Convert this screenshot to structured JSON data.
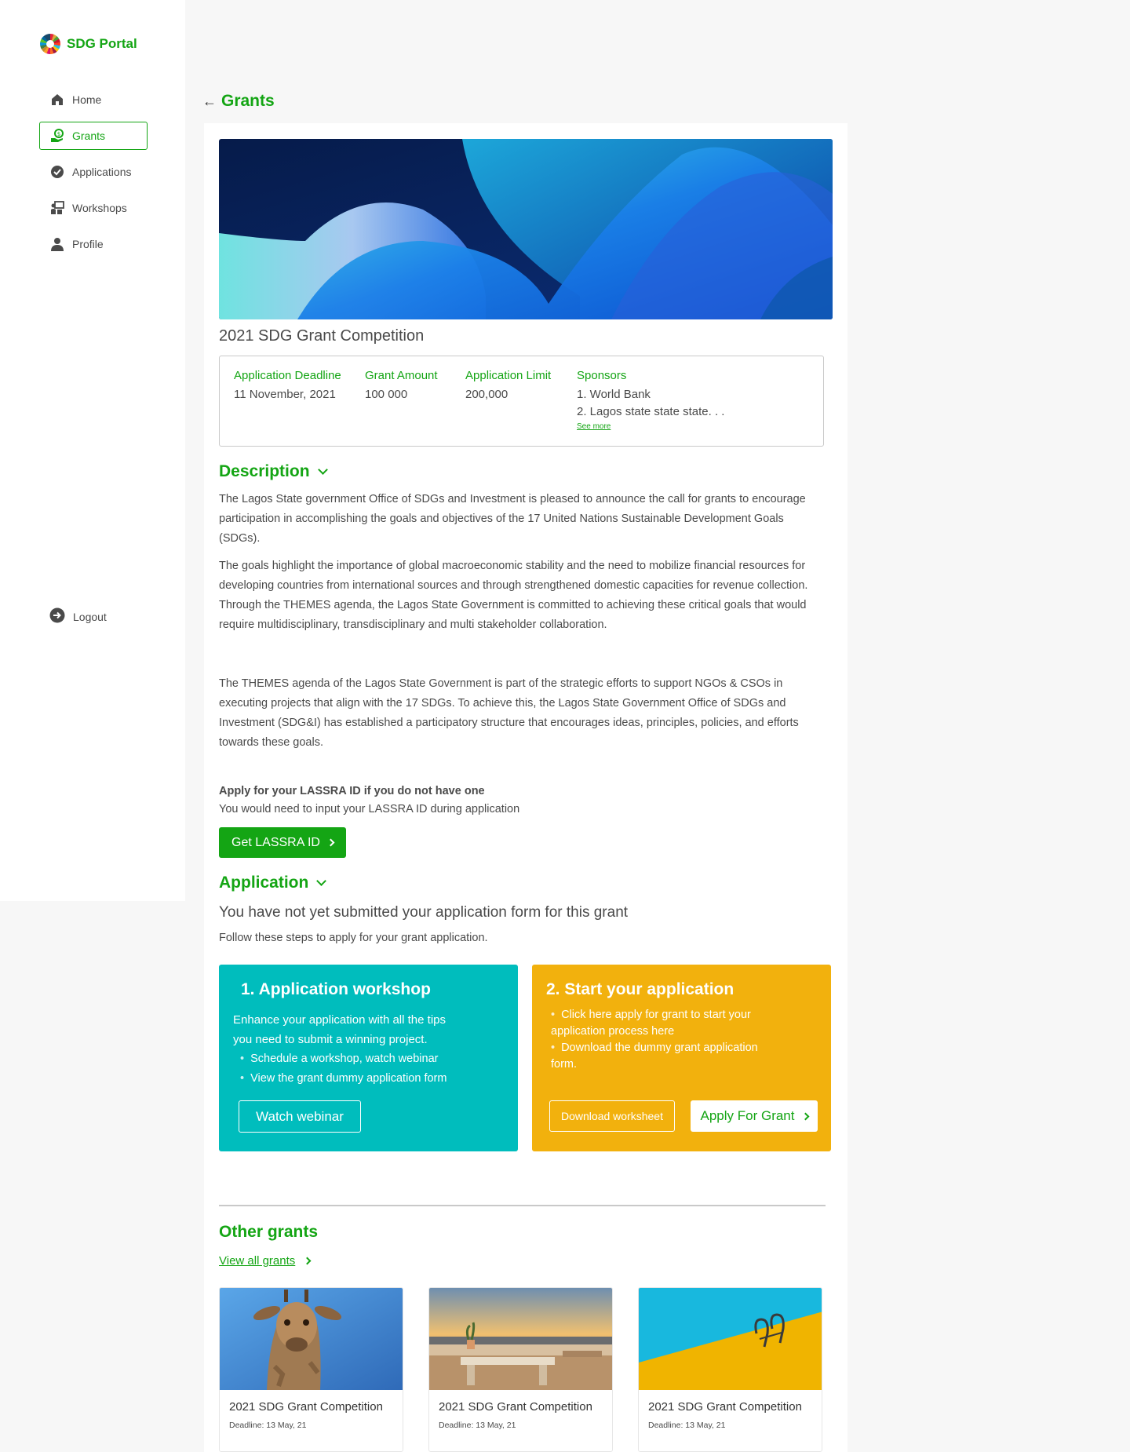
{
  "brand": {
    "name": "SDG Portal",
    "accent": "#14a514"
  },
  "sidebar": {
    "items": [
      {
        "label": "Home",
        "icon": "home-icon"
      },
      {
        "label": "Grants",
        "icon": "grants-icon",
        "active": true
      },
      {
        "label": "Applications",
        "icon": "check-circle-icon"
      },
      {
        "label": "Workshops",
        "icon": "workshop-icon"
      },
      {
        "label": "Profile",
        "icon": "user-icon"
      }
    ],
    "logout": "Logout"
  },
  "header": {
    "back_label": "Grants"
  },
  "grant": {
    "title": "2021 SDG Grant Competition",
    "deadline_label": "Application Deadline",
    "deadline_value": "11 November, 2021",
    "amount_label": "Grant Amount",
    "amount_value": "100 000",
    "limit_label": "Application Limit",
    "limit_value": "200,000",
    "sponsors_label": "Sponsors",
    "sponsors": [
      "1. World Bank",
      "2. Lagos state state state. . ."
    ],
    "see_more": "See more"
  },
  "description": {
    "heading": "Description",
    "paragraphs": [
      "The Lagos State government Office of SDGs and Investment is pleased to announce the call for grants to encourage participation in accomplishing the goals and objectives of the 17 United Nations Sustainable Development Goals (SDGs).",
      "The goals highlight the importance of global macroeconomic stability and the need to mobilize financial resources for developing countries from international sources and through strengthened domestic capacities for revenue collection. Through the THEMES agenda, the Lagos State Government is committed to achieving these critical goals that would require  multidisciplinary, transdisciplinary and multi stakeholder collaboration.",
      "The THEMES agenda of the Lagos State Government is part of the strategic efforts to support NGOs & CSOs in executing projects that align with the 17 SDGs.  To achieve this, the Lagos State Government Office of SDGs and Investment (SDG&I) has established a participatory structure that encourages ideas, principles, policies, and efforts towards these goals."
    ],
    "lassra_heading": "Apply for your LASSRA ID if you do not have one",
    "lassra_sub": "You would need to input your LASSRA ID during application",
    "lassra_button": "Get LASSRA ID"
  },
  "application": {
    "heading": "Application",
    "status": "You have not yet submitted your application form for this grant",
    "instructions": "Follow these steps to apply for your grant application.",
    "step1": {
      "title": "1. Application workshop",
      "text_line1": "Enhance your application with all the tips",
      "text_line2": "you need to submit a winning project.",
      "bullets": [
        "Schedule a workshop, watch webinar",
        "View the grant dummy application form"
      ],
      "button": "Watch webinar",
      "color": "#00bdbd"
    },
    "step2": {
      "title": "2. Start your application",
      "bullets": [
        "Click here apply for grant to start your application process here",
        "Download the dummy grant application form."
      ],
      "download_button": "Download worksheet",
      "apply_button": "Apply For Grant",
      "color": "#f2b10d"
    }
  },
  "other_grants": {
    "heading": "Other grants",
    "view_all": "View all grants",
    "cards": [
      {
        "title": "2021 SDG Grant Competition",
        "deadline": "Deadline: 13 May, 21"
      },
      {
        "title": "2021 SDG Grant Competition",
        "deadline": "Deadline: 13 May, 21"
      },
      {
        "title": "2021 SDG Grant Competition",
        "deadline": "Deadline: 13 May, 21"
      }
    ]
  }
}
